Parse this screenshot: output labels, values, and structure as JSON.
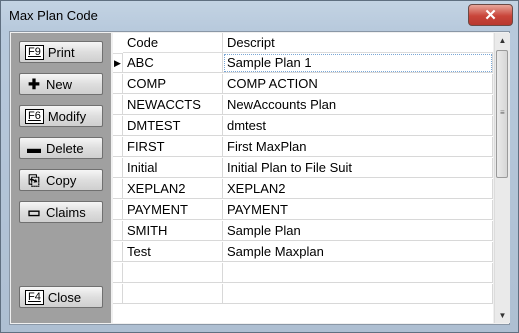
{
  "window": {
    "title": "Max Plan Code",
    "close_glyph": "✕"
  },
  "buttons": [
    {
      "key": "F9",
      "icon": "",
      "label": "Print",
      "name": "print-button",
      "icon_name": ""
    },
    {
      "key": "",
      "icon": "✚",
      "label": "New",
      "name": "new-button",
      "icon_name": "plus-icon"
    },
    {
      "key": "F6",
      "icon": "",
      "label": "Modify",
      "name": "modify-button",
      "icon_name": ""
    },
    {
      "key": "",
      "icon": "▬",
      "label": "Delete",
      "name": "delete-button",
      "icon_name": "minus-icon"
    },
    {
      "key": "",
      "icon": "⎘",
      "label": "Copy",
      "name": "copy-button",
      "icon_name": "copy-icon"
    },
    {
      "key": "",
      "icon": "▭",
      "label": "Claims",
      "name": "claims-button",
      "icon_name": "folders-icon"
    },
    {
      "key": "F4",
      "icon": "",
      "label": "Close",
      "name": "close-form-button",
      "icon_name": ""
    }
  ],
  "grid": {
    "columns": [
      "Code",
      "Descript"
    ],
    "rows": [
      {
        "code": "ABC",
        "descript": "Sample Plan 1",
        "current": "▶"
      },
      {
        "code": "COMP",
        "descript": "COMP ACTION",
        "current": ""
      },
      {
        "code": "NEWACCTS",
        "descript": "NewAccounts Plan",
        "current": ""
      },
      {
        "code": "DMTEST",
        "descript": "dmtest",
        "current": ""
      },
      {
        "code": "FIRST",
        "descript": "First MaxPlan",
        "current": ""
      },
      {
        "code": "Initial",
        "descript": "Initial Plan to File Suit",
        "current": ""
      },
      {
        "code": "XEPLAN2",
        "descript": "XEPLAN2",
        "current": ""
      },
      {
        "code": "PAYMENT",
        "descript": "PAYMENT",
        "current": ""
      },
      {
        "code": "SMITH",
        "descript": "Sample Plan",
        "current": ""
      },
      {
        "code": "Test",
        "descript": "Sample Maxplan",
        "current": ""
      },
      {
        "code": "",
        "descript": "",
        "current": ""
      },
      {
        "code": "",
        "descript": "",
        "current": ""
      }
    ]
  },
  "scrollbar": {
    "up": "▲",
    "down": "▼",
    "grip": "≡"
  }
}
